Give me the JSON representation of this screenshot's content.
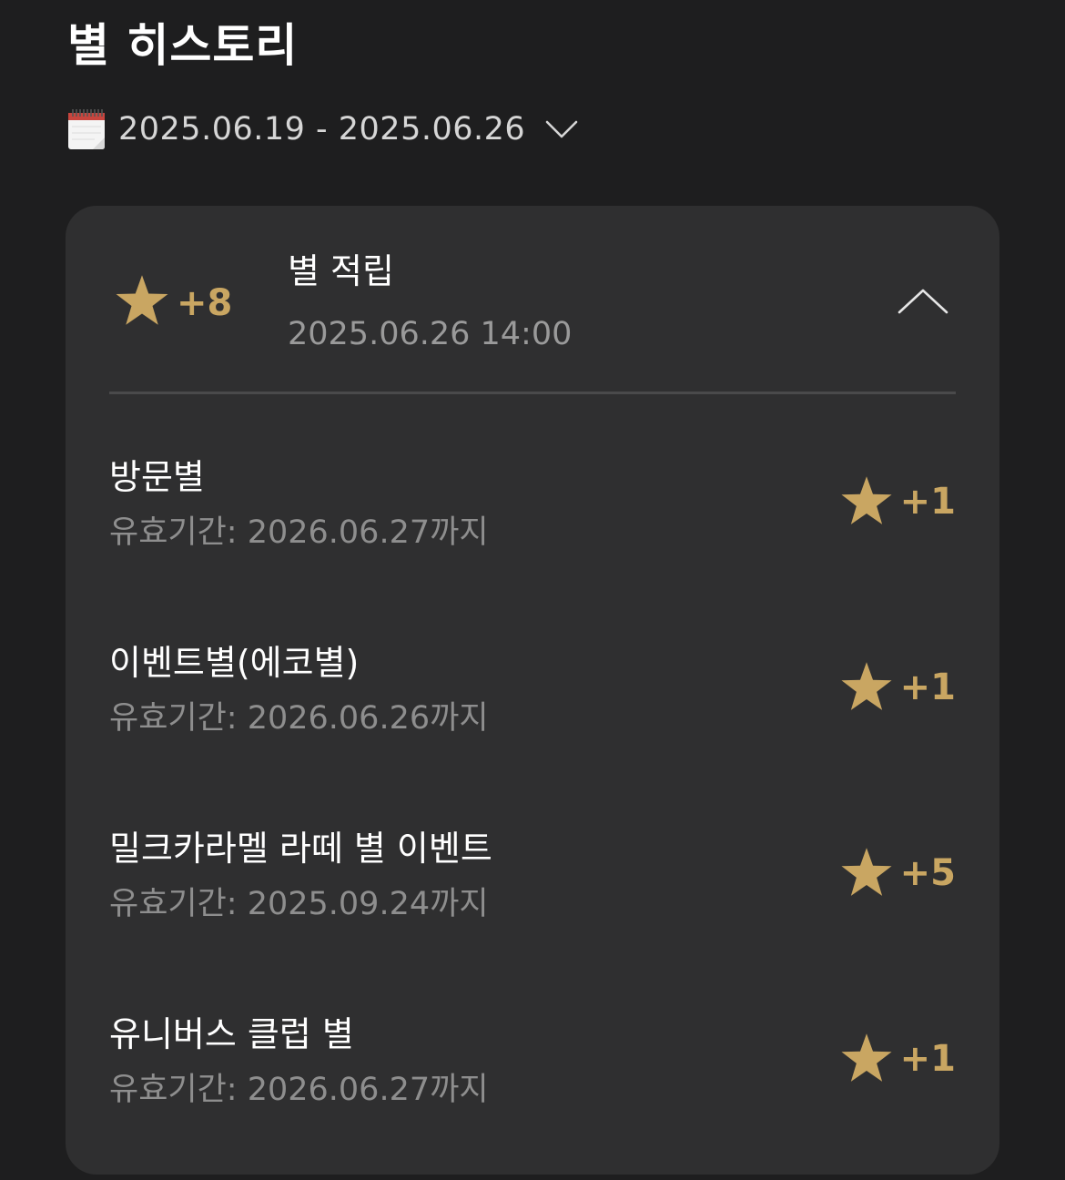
{
  "title": "별 히스토리",
  "date_range": {
    "icon": "calendar-icon",
    "label": "2025.06.19 - 2025.06.26",
    "toggle_icon": "chevron-down-icon"
  },
  "summary": {
    "icon": "star-icon",
    "amount": "+8",
    "title": "별 적립",
    "datetime": "2025.06.26 14:00",
    "toggle_icon": "chevron-up-icon"
  },
  "items": [
    {
      "name": "방문별",
      "expiry": "유효기간: 2026.06.27까지",
      "amount": "+1"
    },
    {
      "name": "이벤트별(에코별)",
      "expiry": "유효기간: 2026.06.26까지",
      "amount": "+1"
    },
    {
      "name": "밀크카라멜 라떼 별 이벤트",
      "expiry": "유효기간: 2025.09.24까지",
      "amount": "+5"
    },
    {
      "name": "유니버스 클럽 별",
      "expiry": "유효기간: 2026.06.27까지",
      "amount": "+1"
    }
  ],
  "colors": {
    "background": "#1e1e1f",
    "card": "#2f2f30",
    "accent_gold": "#c9a662",
    "secondary_text": "#9a9a9a"
  }
}
